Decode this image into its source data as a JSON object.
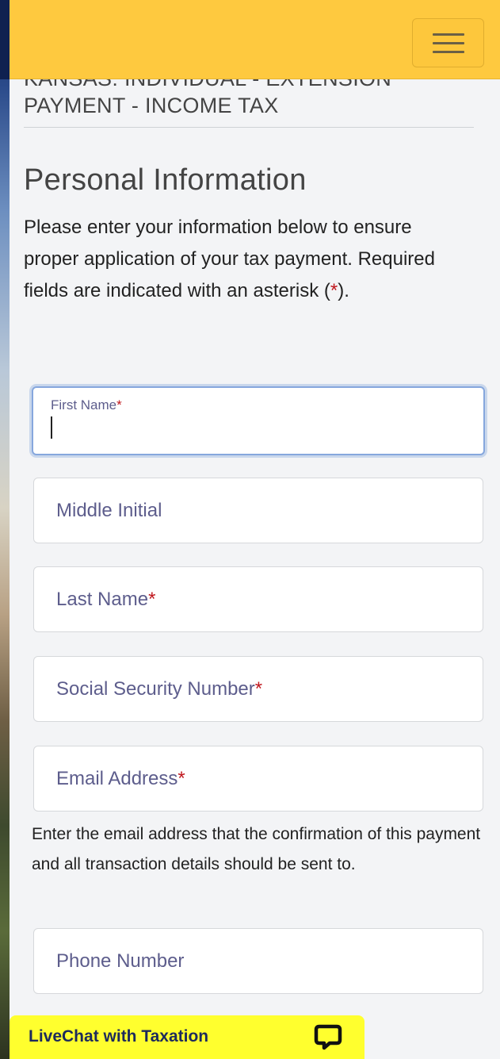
{
  "header": {
    "title_line1": "KANSAS: INDIVIDUAL - EXTENSION",
    "title_line2": "PAYMENT - INCOME TAX",
    "menu_icon": "hamburger-icon"
  },
  "section": {
    "title": "Personal Information",
    "intro": "Please enter your information below to ensure proper application of your tax payment. Required fields are indicated with an asterisk (",
    "intro_end": ").",
    "asterisk": "*"
  },
  "fields": {
    "first_name": {
      "label": "First Name",
      "required": true,
      "value": ""
    },
    "middle_initial": {
      "placeholder": "Middle Initial",
      "required": false
    },
    "last_name": {
      "placeholder": "Last Name",
      "required": true
    },
    "ssn": {
      "placeholder": "Social Security Number",
      "required": true
    },
    "email": {
      "placeholder": "Email Address",
      "required": true
    },
    "phone": {
      "placeholder": "Phone Number",
      "required": false
    }
  },
  "email_help": "Enter the email address that the confirmation of this payment and all transaction details should be sent to.",
  "livechat": {
    "label": "LiveChat with Taxation",
    "icon": "chat-bubble-icon"
  },
  "colors": {
    "navbar": "#fec93f",
    "livechat": "#ffff2e",
    "required_asterisk": "#c0171d",
    "focus_border": "#86a7dd"
  }
}
